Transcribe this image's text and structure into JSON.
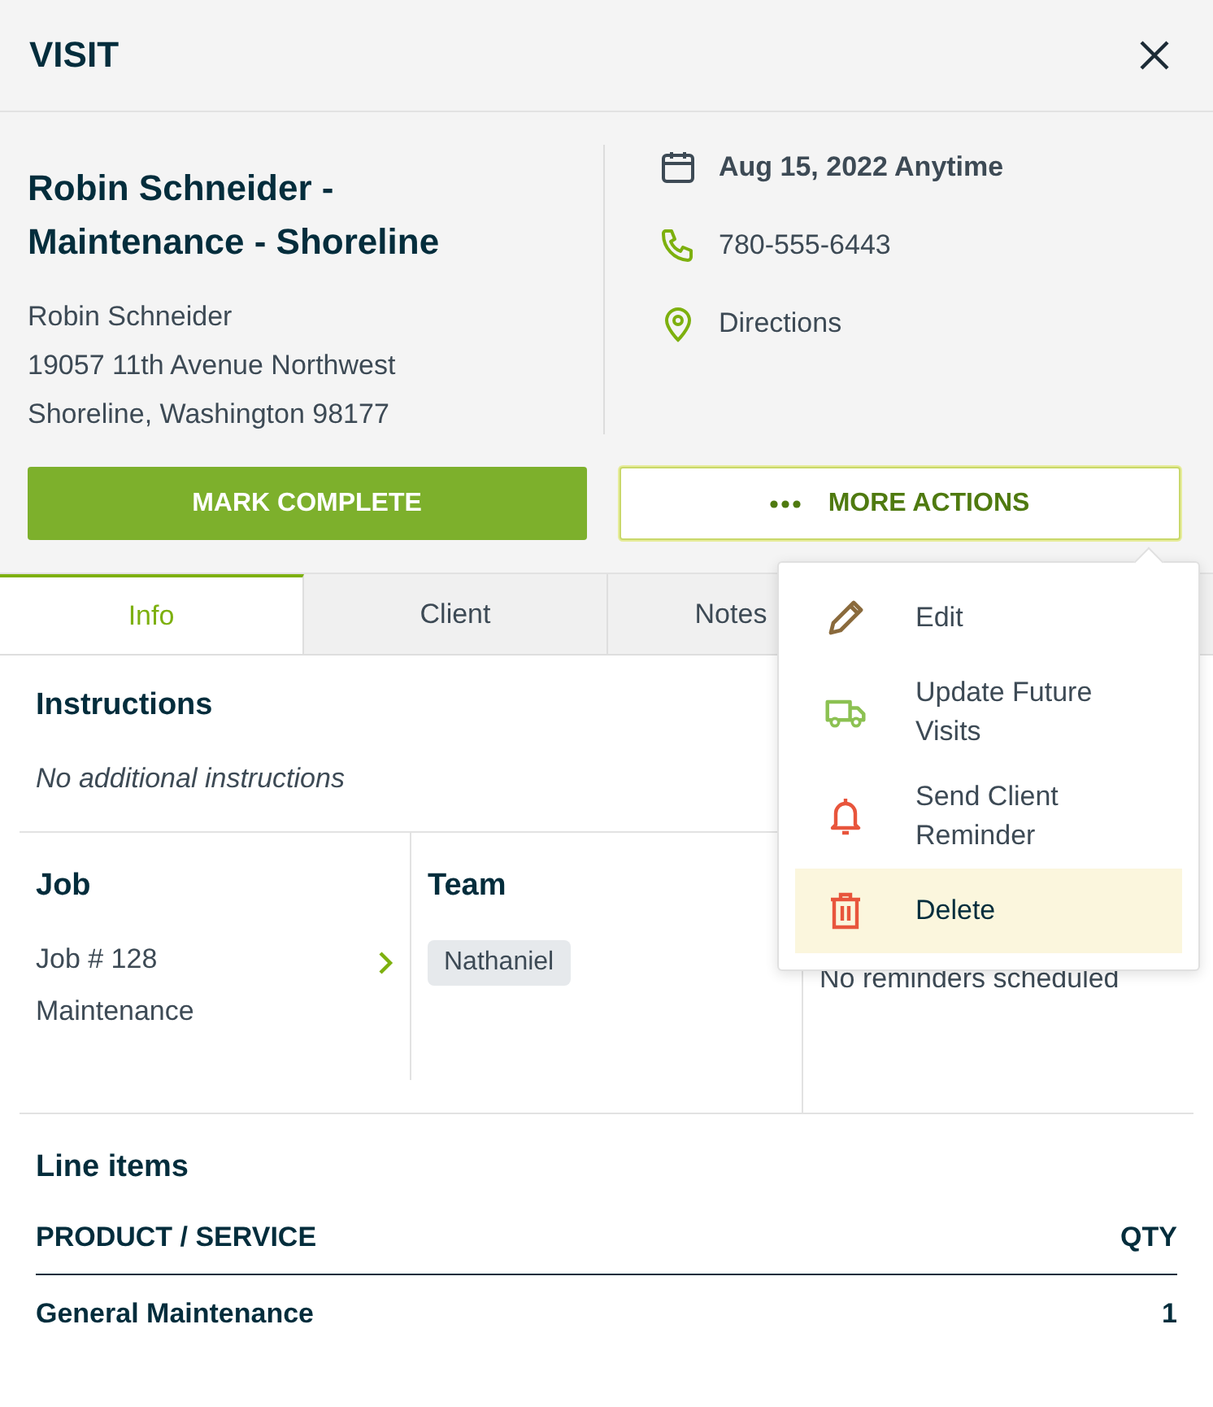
{
  "header": {
    "title": "VISIT"
  },
  "visit": {
    "title": "Robin Schneider - Maintenance - Shoreline",
    "client": "Robin Schneider",
    "address_lines": [
      "19057 11th Avenue Northwest",
      "Shoreline, Washington 98177"
    ],
    "details": [
      {
        "kind": "date",
        "text": "Aug 15, 2022 Anytime"
      },
      {
        "kind": "phone",
        "text": "780-555-6443"
      },
      {
        "kind": "location",
        "text": "Directions"
      }
    ]
  },
  "actions": {
    "primary": "MARK COMPLETE",
    "secondary": "MORE ACTIONS",
    "expanded": true
  },
  "menu": [
    {
      "kind": "edit",
      "label": "Edit",
      "highlighted": false
    },
    {
      "kind": "truck",
      "label": "Update Future Visits",
      "highlighted": false
    },
    {
      "kind": "bell",
      "label": "Send Client Reminder",
      "highlighted": false
    },
    {
      "kind": "delete",
      "label": "Delete",
      "highlighted": true
    }
  ],
  "tabs": [
    {
      "label": "Info",
      "selected": true
    },
    {
      "label": "Client",
      "selected": false
    },
    {
      "label": "Notes",
      "selected": false
    }
  ],
  "instructions": {
    "heading": "Instructions",
    "text": "No additional instructions"
  },
  "job": {
    "heading": "Job",
    "number": "Job # 128",
    "type": "Maintenance"
  },
  "team": {
    "heading": "Team",
    "members": [
      "Nathaniel"
    ]
  },
  "reminders": {
    "text": "No reminders scheduled"
  },
  "line_items": {
    "heading": "Line items",
    "columns": [
      "PRODUCT / SERVICE",
      "QTY"
    ],
    "rows": [
      {
        "name": "General Maintenance",
        "qty": "1"
      }
    ]
  }
}
